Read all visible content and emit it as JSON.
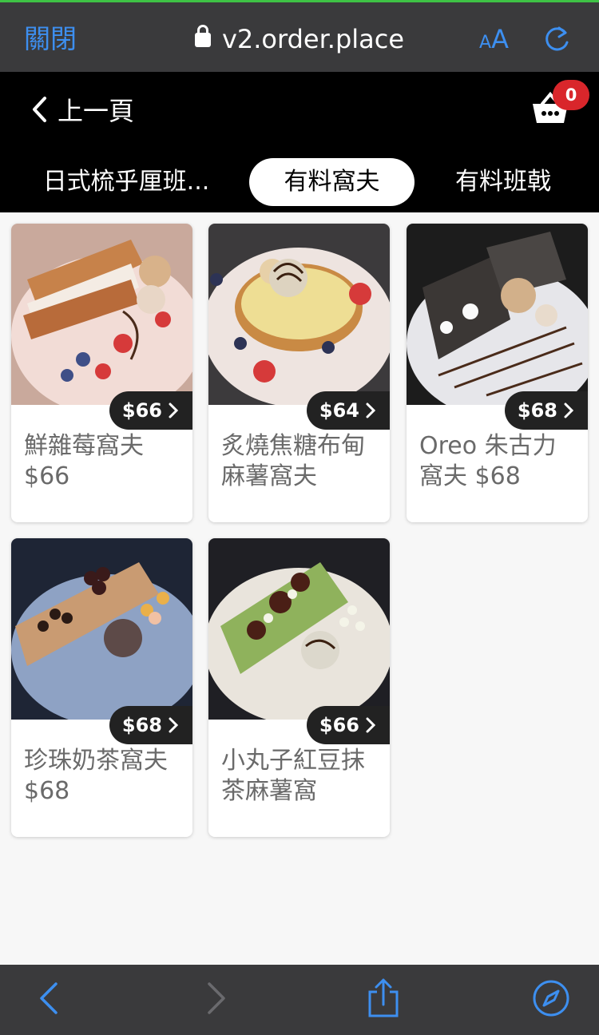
{
  "browser": {
    "close_label": "關閉",
    "url": "v2.order.place",
    "text_size_small": "A",
    "text_size_large": "A",
    "accent": "#3d8ff0"
  },
  "header": {
    "back_label": "上一頁",
    "cart_count": "0"
  },
  "tabs": [
    {
      "label": "日式梳乎厘班...",
      "active": false
    },
    {
      "label": "有料窩夫",
      "active": true
    },
    {
      "label": "有料班戟",
      "active": false
    }
  ],
  "products": [
    {
      "price": "$66",
      "name": "鮮雜莓窩夫 $66"
    },
    {
      "price": "$64",
      "name": "炙燒焦糖布甸麻薯窩夫"
    },
    {
      "price": "$68",
      "name": "Oreo 朱古力窩夫 $68"
    },
    {
      "price": "$68",
      "name": "珍珠奶茶窩夫 $68"
    },
    {
      "price": "$66",
      "name": "小丸子紅豆抹茶麻薯窩"
    }
  ],
  "toolbar": {
    "icons": [
      "back-arrow-icon",
      "forward-arrow-icon",
      "share-icon",
      "compass-icon"
    ]
  }
}
